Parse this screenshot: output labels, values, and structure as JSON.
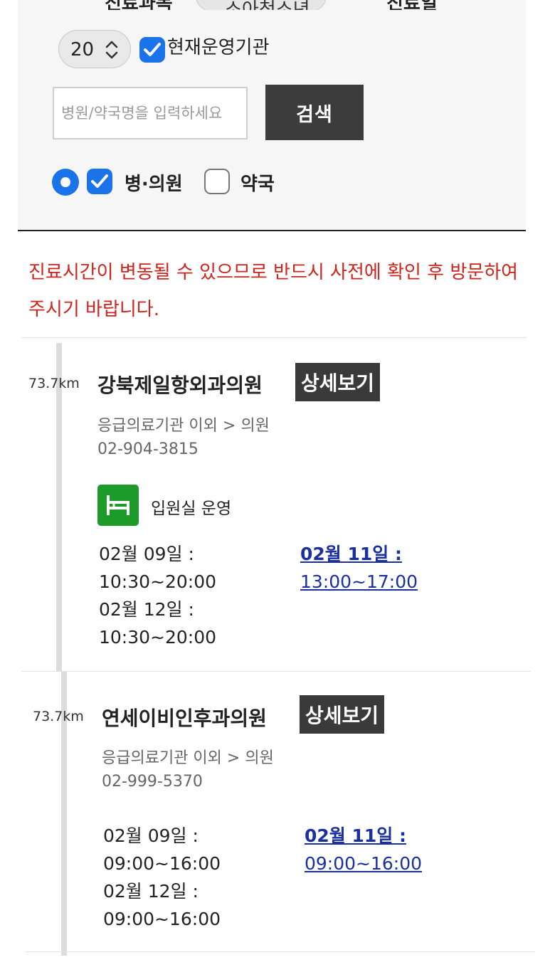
{
  "filters": {
    "dept_label": "진료과목",
    "dept_value": "소아청소년과",
    "date_label": "진료일",
    "count_value": "20",
    "operating_label": "현재운영기관",
    "operating_checked": true,
    "search_placeholder": "병원/약국명을 입력하세요",
    "search_button": "검색",
    "type_hospital_label": "병·의원",
    "type_hospital_checked": true,
    "type_pharmacy_label": "약국",
    "type_pharmacy_checked": false
  },
  "notice": "진료시간이 변동될 수 있으므로 반드시 사전에 확인 후 방문하여 주시기 바랍니다.",
  "results": [
    {
      "distance": "73.7km",
      "name": "강북제일항외과의원",
      "detail_button": "상세보기",
      "category": "응급의료기관 이외 > 의원",
      "phone": "02-904-3815",
      "ward_label": "입원실 운영",
      "hours_left": [
        "02월 09일 :",
        "10:30~20:00",
        "02월 12일 :",
        "10:30~20:00"
      ],
      "hours_link_date": "02월 11일 :",
      "hours_link_time": "13:00~17:00"
    },
    {
      "distance": "73.7km",
      "name": "연세이비인후과의원",
      "detail_button": "상세보기",
      "category": "응급의료기관 이외 > 의원",
      "phone": "02-999-5370",
      "hours_left": [
        "02월 09일 :",
        "09:00~16:00",
        "02월 12일 :",
        "09:00~16:00"
      ],
      "hours_link_date": "02월 11일 :",
      "hours_link_time": "09:00~16:00"
    }
  ],
  "colors": {
    "notice_red": "#d0221a",
    "checkbox_blue": "#1a73e8",
    "link_blue": "#1a2fa0",
    "ward_green": "#1c9a2a",
    "button_dark": "#3a3a3a"
  },
  "icons": [
    "checkmark-icon",
    "select-arrows-icon",
    "bed-icon"
  ]
}
